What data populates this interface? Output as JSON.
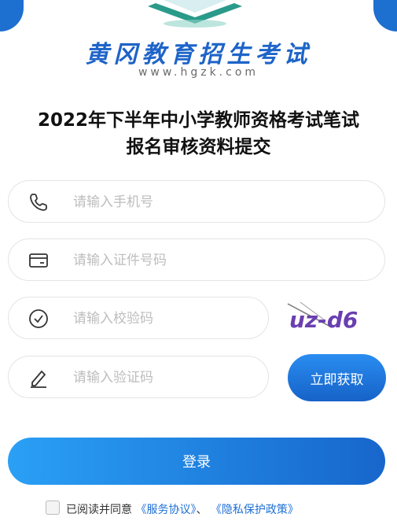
{
  "brand": {
    "name": "黄冈教育招生考试",
    "domain": "www.hgzk.com"
  },
  "title": {
    "line1": "2022年下半年中小学教师资格考试笔试",
    "line2": "报名审核资料提交"
  },
  "form": {
    "phone_placeholder": "请输入手机号",
    "id_placeholder": "请输入证件号码",
    "check_placeholder": "请输入校验码",
    "code_placeholder": "请输入验证码",
    "captcha_text": "uz-d6",
    "get_code_label": "立即获取",
    "login_label": "登录"
  },
  "agreement": {
    "prefix": "已阅读并同意",
    "service_link": "《服务协议》",
    "separator": "、",
    "privacy_link": "《隐私保护政策》"
  },
  "icons": [
    "phone-icon",
    "id-card-icon",
    "check-circle-icon",
    "pencil-icon"
  ],
  "colors": {
    "primary": "#1e6fd6",
    "background": "#1d6fd0",
    "link": "#1e6fd6"
  }
}
